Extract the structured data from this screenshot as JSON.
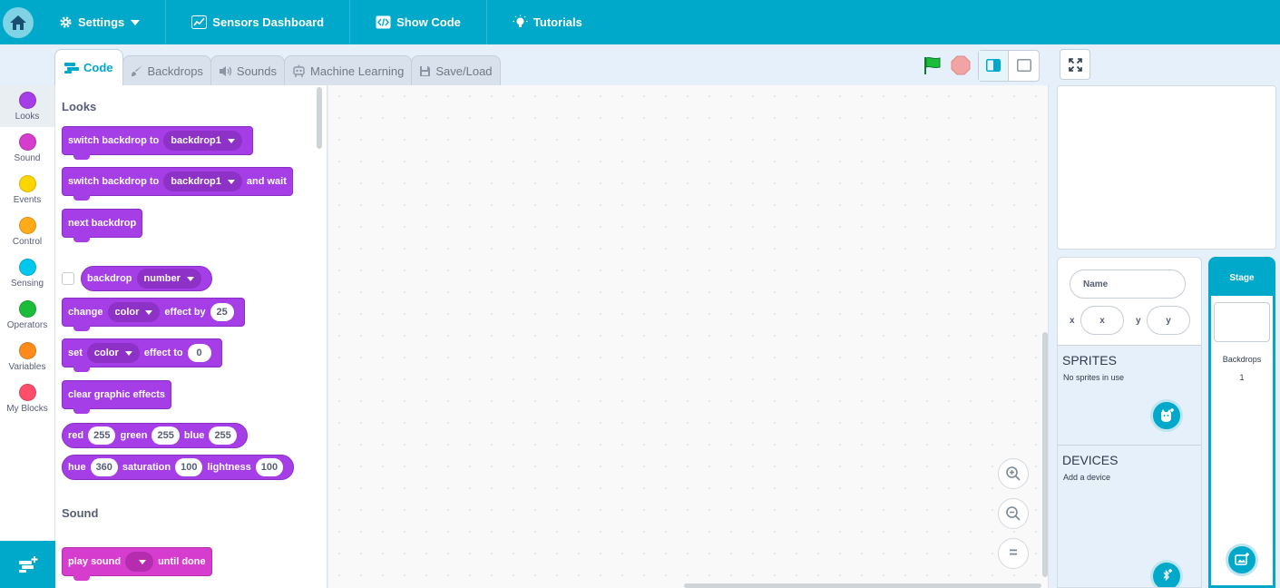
{
  "topbar": {
    "menu": [
      {
        "label": "Settings",
        "icon": "gear-icon"
      },
      {
        "label": "Sensors Dashboard",
        "icon": "chart-icon"
      },
      {
        "label": "Show Code",
        "icon": "code-icon"
      },
      {
        "label": "Tutorials",
        "icon": "lightbulb-icon"
      }
    ]
  },
  "tabs": [
    {
      "label": "Code",
      "icon": "code-blocks-icon"
    },
    {
      "label": "Backdrops",
      "icon": "brush-icon"
    },
    {
      "label": "Sounds",
      "icon": "speaker-icon"
    },
    {
      "label": "Machine Learning",
      "icon": "robot-icon"
    },
    {
      "label": "Save/Load",
      "icon": "save-icon"
    }
  ],
  "colors": {
    "accent": "#00a9c9",
    "looks": "#a53ee6",
    "sound": "#d63cce",
    "events": "#ffd500",
    "control": "#ffab19",
    "sensing": "#00c7ee",
    "operators": "#1bbc3a",
    "variables": "#ff8c1a",
    "myblocks": "#ff4d6a"
  },
  "categories": [
    {
      "label": "Looks"
    },
    {
      "label": "Sound"
    },
    {
      "label": "Events"
    },
    {
      "label": "Control"
    },
    {
      "label": "Sensing"
    },
    {
      "label": "Operators"
    },
    {
      "label": "Variables"
    },
    {
      "label": "My Blocks"
    }
  ],
  "palette": {
    "looks_title": "Looks",
    "sound_title": "Sound",
    "blocks": {
      "switch_backdrop": {
        "text": "switch backdrop to",
        "value": "backdrop1"
      },
      "switch_backdrop_wait": {
        "text": "switch backdrop to",
        "value": "backdrop1",
        "suffix": "and wait"
      },
      "next_backdrop": {
        "text": "next backdrop"
      },
      "backdrop_reporter": {
        "text": "backdrop",
        "value": "number"
      },
      "change_effect": {
        "text": "change",
        "value": "color",
        "mid": "effect by",
        "num": "25"
      },
      "set_effect": {
        "text": "set",
        "value": "color",
        "mid": "effect to",
        "num": "0"
      },
      "clear_effects": {
        "text": "clear graphic effects"
      },
      "rgb": {
        "r_label": "red",
        "r": "255",
        "g_label": "green",
        "g": "255",
        "b_label": "blue",
        "b": "255"
      },
      "hsl": {
        "h_label": "hue",
        "h": "360",
        "s_label": "saturation",
        "s": "100",
        "l_label": "lightness",
        "l": "100"
      },
      "play_sound": {
        "text": "play sound",
        "suffix": "until done"
      }
    }
  },
  "zoom": {
    "in": "+",
    "out": "−",
    "reset": "="
  },
  "sprite_info": {
    "name_placeholder": "Name",
    "x_label": "x",
    "x_placeholder": "x",
    "y_label": "y",
    "y_placeholder": "y"
  },
  "sprites": {
    "title": "SPRITES",
    "empty": "No sprites in use"
  },
  "devices": {
    "title": "DEVICES",
    "empty": "Add a device"
  },
  "stage_panel": {
    "title": "Stage",
    "backdrops_label": "Backdrops",
    "backdrops_count": "1"
  }
}
